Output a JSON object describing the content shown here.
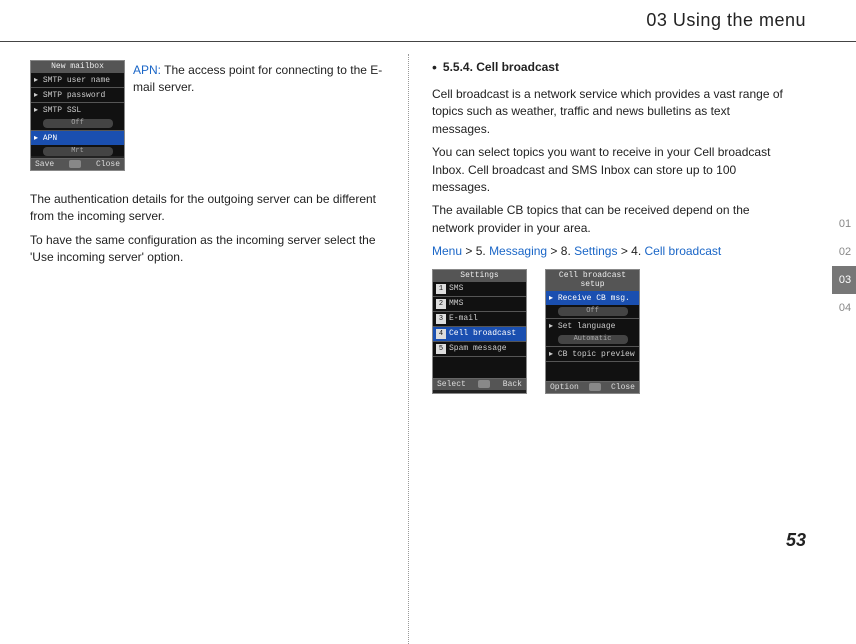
{
  "header": {
    "title": "03 Using the menu"
  },
  "left": {
    "mini": {
      "title": "New mailbox",
      "r1": "SMTP user name",
      "r2": "SMTP password",
      "r3": "SMTP SSL",
      "s1": "Off",
      "r4": "APN",
      "s2": "Mrt",
      "fL": "Save",
      "fR": "Close"
    },
    "apn_k": "APN:",
    "apn_t": " The access point for connecting to the E-mail server.",
    "p1": "The authentication details for the outgoing server can be different from the incoming server.",
    "p2": "To have the same configuration as the incoming server select the 'Use incoming server' option."
  },
  "right": {
    "h": "5.5.4. Cell broadcast",
    "p1": "Cell broadcast is a network service which provides a vast range of topics such as weather, traffic and news bulletins as text messages.",
    "p2": "You can select topics you want to receive in your Cell broadcast Inbox. Cell broadcast and SMS Inbox can store up to 100 messages.",
    "p3": "The available CB topics that can be received depend on the network provider in your area.",
    "bc": {
      "a": "Menu",
      "b": " > 5. ",
      "c": "Messaging",
      "d": " > 8. ",
      "e": "Settings",
      "f": " > 4. ",
      "g": "Cell broadcast"
    },
    "s1": {
      "title": "Settings",
      "i1": "SMS",
      "i2": "MMS",
      "i3": "E-mail",
      "i4": "Cell broadcast",
      "i5": "Spam message",
      "fL": "Select",
      "fR": "Back"
    },
    "s2": {
      "title": "Cell broadcast setup",
      "r1": "Receive CB msg.",
      "v1": "Off",
      "r2": "Set language",
      "v2": "Automatic",
      "r3": "CB topic preview",
      "fL": "Option",
      "fR": "Close"
    }
  },
  "tabs": {
    "a": "01",
    "b": "02",
    "c": "03",
    "d": "04"
  },
  "page": "53"
}
